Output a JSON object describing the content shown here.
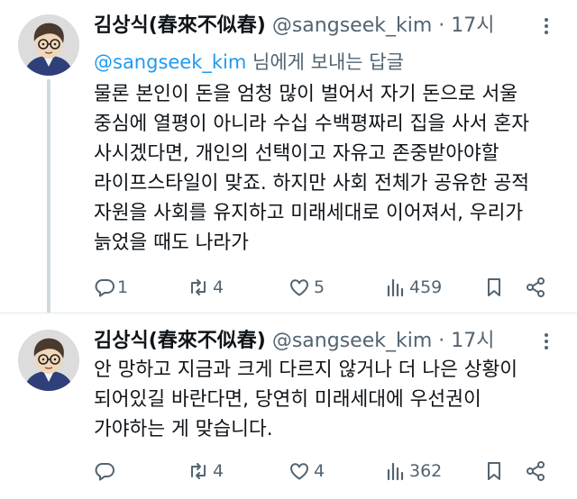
{
  "tweets": [
    {
      "author_name": "김상식(春來不似春)",
      "handle": "@sangseek_kim",
      "separator": "·",
      "time": "17시",
      "reply_to": {
        "mention": "@sangseek_kim",
        "suffix": " 님에게 보내는 답글"
      },
      "lines": [
        "물론 본인이 돈을 엄청 많이 벌어서 자기 돈으로 서울",
        "중심에 열평이 아니라 수십 수백평짜리 집을 사서 혼자",
        "사시겠다면, 개인의 선택이고 자유고 존중받아야할",
        "라이프스타일이 맞죠. 하지만 사회 전체가 공유한 공적",
        "자원을 사회를 유지하고 미래세대로 이어져서, 우리가",
        "늙었을 때도 나라가"
      ],
      "stats": {
        "replies": "1",
        "retweets": "4",
        "likes": "5",
        "views": "459"
      }
    },
    {
      "author_name": "김상식(春來不似春)",
      "handle": "@sangseek_kim",
      "separator": "·",
      "time": "17시",
      "lines": [
        "안 망하고 지금과 크게 다르지 않거나 더 나은 상황이",
        "되어있길 바란다면, 당연히 미래세대에 우선권이",
        "가야하는 게 맞습니다."
      ],
      "stats": {
        "replies": "",
        "retweets": "4",
        "likes": "4",
        "views": "362"
      }
    }
  ],
  "icons": {
    "reply": "reply-icon",
    "retweet": "retweet-icon",
    "like": "heart-icon",
    "views": "views-chart-icon",
    "bookmark": "bookmark-icon",
    "share": "share-icon",
    "more": "more-dots-icon"
  },
  "colors": {
    "text": "#0f1419",
    "muted": "#536471",
    "link": "#1d9bf0",
    "thread_line": "#cfd9de"
  }
}
